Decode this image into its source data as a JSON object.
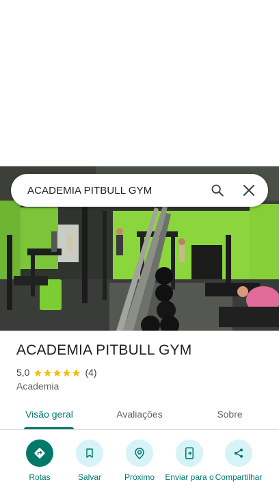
{
  "search": {
    "query": "ACADEMIA PITBULL GYM"
  },
  "place": {
    "name": "ACADEMIA PITBULL GYM",
    "rating": "5,0",
    "stars": 5,
    "review_count": "(4)",
    "category": "Academia"
  },
  "tabs": [
    {
      "label": "Visão geral"
    },
    {
      "label": "Avaliações"
    },
    {
      "label": "Sobre"
    }
  ],
  "actions": [
    {
      "label": "Rotas",
      "icon": "directions-icon"
    },
    {
      "label": "Salvar",
      "icon": "bookmark-icon"
    },
    {
      "label": "Próximo",
      "icon": "nearby-icon"
    },
    {
      "label": "Enviar para o",
      "icon": "send-to-phone-icon"
    },
    {
      "label": "Compartilhar",
      "icon": "share-icon"
    }
  ],
  "colors": {
    "accent": "#00796b",
    "action_bg": "#d6f3f7",
    "star": "#fbbc04",
    "gym_wall": "#8bd63c"
  }
}
